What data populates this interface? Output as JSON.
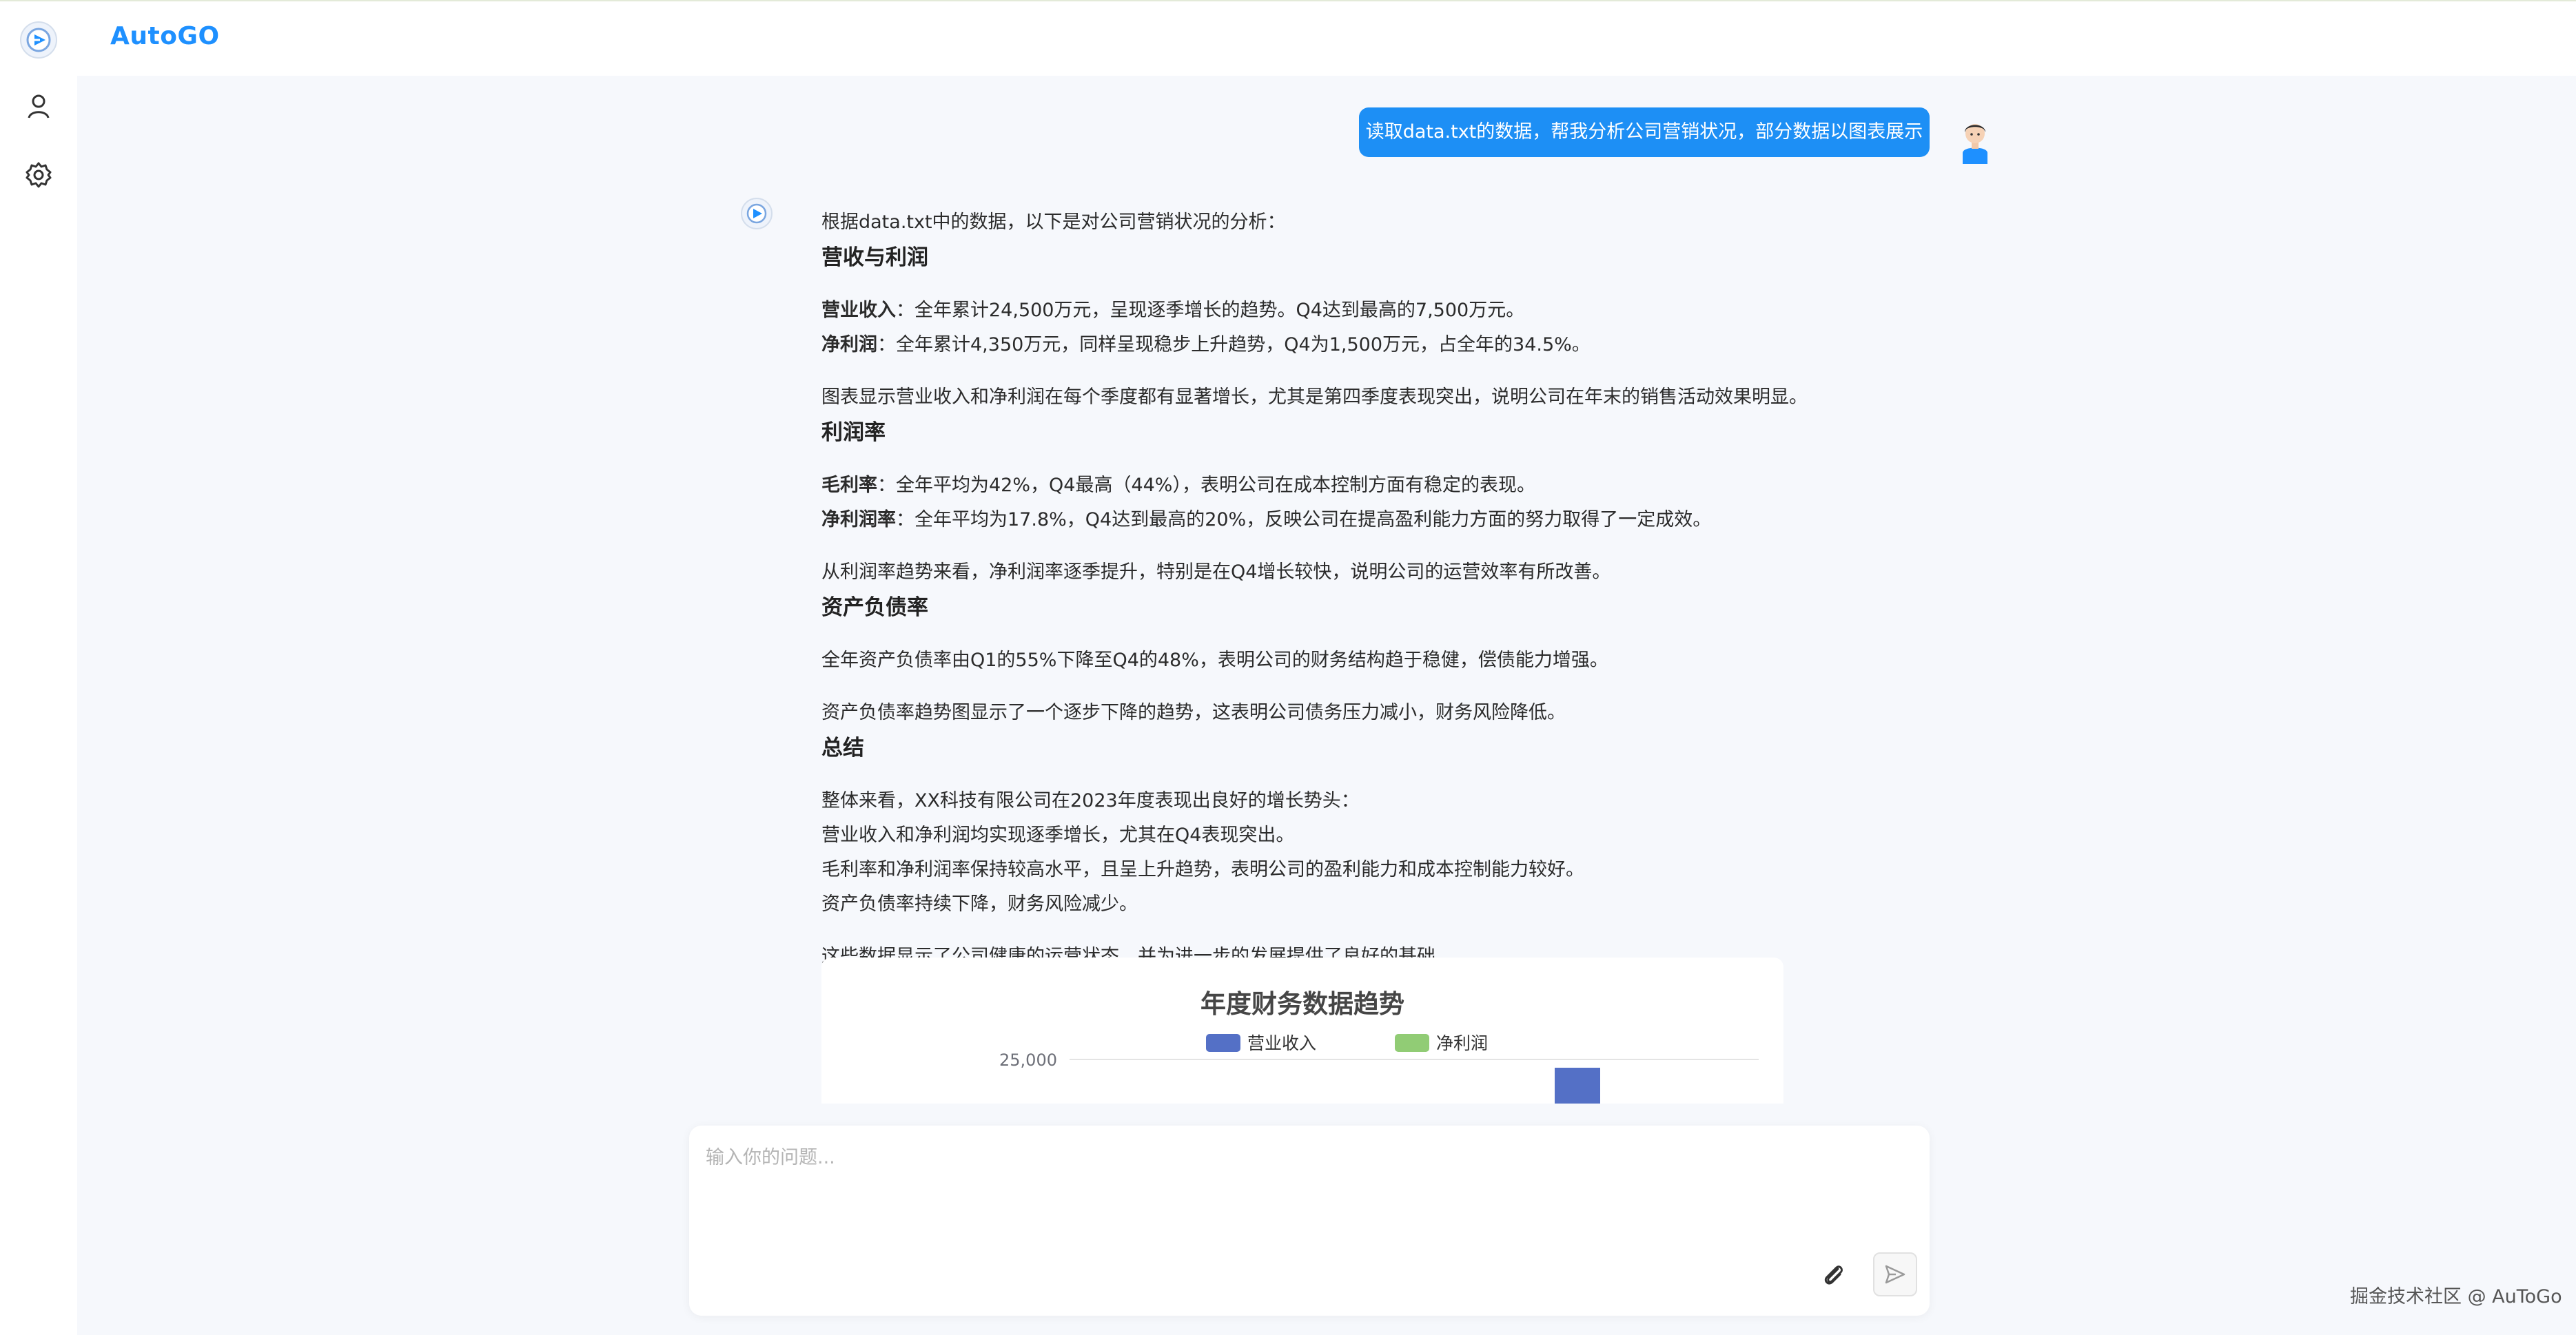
{
  "app": {
    "brand": "AutoGO"
  },
  "sidebar": {
    "items": [
      {
        "icon": "logo-icon"
      },
      {
        "icon": "user-icon"
      },
      {
        "icon": "gear-icon"
      }
    ]
  },
  "conversation": {
    "user_message": "读取data.txt的数据，帮我分析公司营销状况，部分数据以图表展示",
    "assistant": {
      "intro": "根据data.txt中的数据，以下是对公司营销状况的分析：",
      "sections": [
        {
          "heading": "营收与利润",
          "lines": [
            {
              "bold": "营业收入",
              "text": "：全年累计24,500万元，呈现逐季增长的趋势。Q4达到最高的7,500万元。"
            },
            {
              "bold": "净利润",
              "text": "：全年累计4,350万元，同样呈现稳步上升趋势，Q4为1,500万元，占全年的34.5%。"
            }
          ],
          "note": "图表显示营业收入和净利润在每个季度都有显著增长，尤其是第四季度表现突出，说明公司在年末的销售活动效果明显。"
        },
        {
          "heading": "利润率",
          "lines": [
            {
              "bold": "毛利率",
              "text": "：全年平均为42%，Q4最高（44%），表明公司在成本控制方面有稳定的表现。"
            },
            {
              "bold": "净利润率",
              "text": "：全年平均为17.8%，Q4达到最高的20%，反映公司在提高盈利能力方面的努力取得了一定成效。"
            }
          ],
          "note": "从利润率趋势来看，净利润率逐季提升，特别是在Q4增长较快，说明公司的运营效率有所改善。"
        },
        {
          "heading": "资产负债率",
          "lines": [
            {
              "bold": "",
              "text": "全年资产负债率由Q1的55%下降至Q4的48%，表明公司的财务结构趋于稳健，偿债能力增强。"
            }
          ],
          "note": "资产负债率趋势图显示了一个逐步下降的趋势，这表明公司债务压力减小，财务风险降低。"
        },
        {
          "heading": "总结",
          "lines": [
            {
              "bold": "",
              "text": "整体来看，XX科技有限公司在2023年度表现出良好的增长势头："
            },
            {
              "bold": "",
              "text": "营业收入和净利润均实现逐季增长，尤其在Q4表现突出。"
            },
            {
              "bold": "",
              "text": "毛利率和净利润率保持较高水平，且呈上升趋势，表明公司的盈利能力和成本控制能力较好。"
            },
            {
              "bold": "",
              "text": "资产负债率持续下降，财务风险减少。"
            }
          ],
          "note": "这些数据显示了公司健康的运营状态，并为进一步的发展提供了良好的基础。"
        }
      ]
    }
  },
  "chart_data": {
    "type": "bar",
    "title": "年度财务数据趋势",
    "legend_position": "top-center",
    "series": [
      {
        "name": "营业收入",
        "color": "#5470c6"
      },
      {
        "name": "净利润",
        "color": "#91cc75"
      }
    ],
    "y_tick_labels": [
      "25,000"
    ],
    "ylim_max": 25000,
    "grid": true,
    "visible_bars": [
      {
        "series": "营业收入",
        "value_above": 24500
      }
    ]
  },
  "input": {
    "placeholder": "输入你的问题..."
  },
  "watermark": "掘金技术社区 @ AuToGo"
}
